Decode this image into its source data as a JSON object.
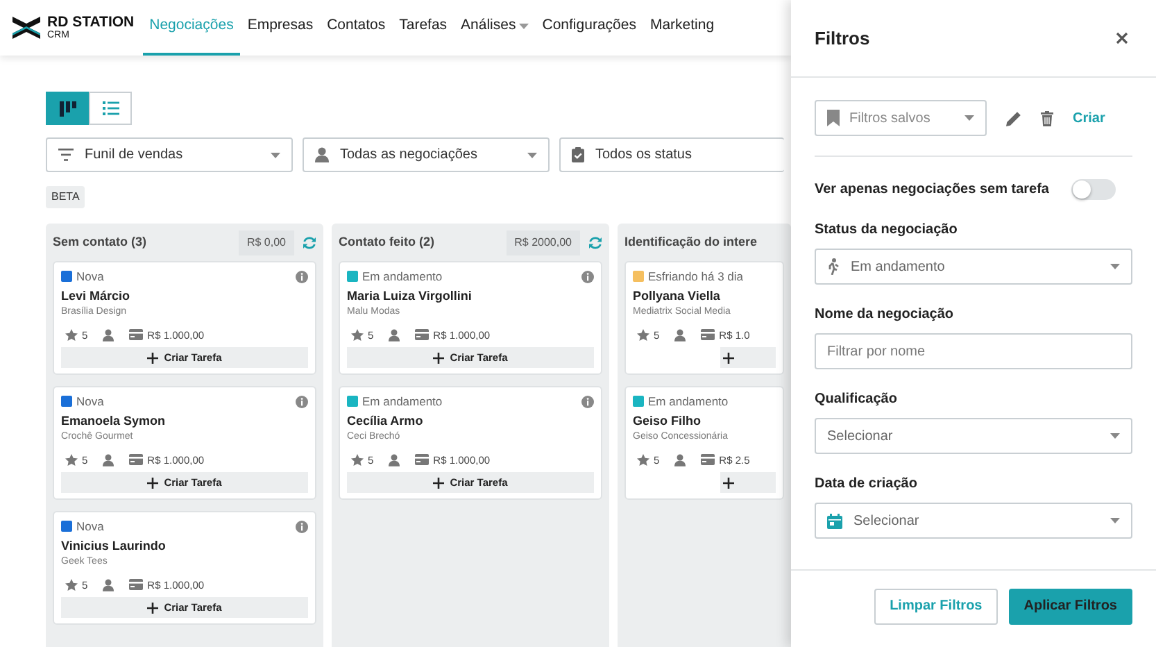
{
  "logo": {
    "brand": "RD STATION",
    "product": "CRM"
  },
  "nav": [
    {
      "label": "Negociações",
      "selected": true,
      "dropdown": false
    },
    {
      "label": "Empresas",
      "selected": false,
      "dropdown": false
    },
    {
      "label": "Contatos",
      "selected": false,
      "dropdown": false
    },
    {
      "label": "Tarefas",
      "selected": false,
      "dropdown": false
    },
    {
      "label": "Análises",
      "selected": false,
      "dropdown": true
    },
    {
      "label": "Configurações",
      "selected": false,
      "dropdown": false
    },
    {
      "label": "Marketing",
      "selected": false,
      "dropdown": false
    }
  ],
  "view_toggle": [
    {
      "kind": "board",
      "selected": true
    },
    {
      "kind": "list",
      "selected": false
    }
  ],
  "filters": [
    {
      "kind": "funnel",
      "value": "Funil de vendas"
    },
    {
      "kind": "user",
      "value": "Todas as negociações"
    },
    {
      "kind": "status",
      "value": "Todos os status"
    }
  ],
  "beta_badge": "BETA",
  "columns": [
    {
      "title": "Sem contato (3)",
      "total": "R$ 0,00",
      "cards": [
        {
          "status": "Nova",
          "color": "#1a6fd8",
          "name": "Levi Márcio",
          "company": "Brasília Design",
          "rating": "5",
          "amount": "R$ 1.000,00",
          "task_button": "Criar Tarefa"
        },
        {
          "status": "Nova",
          "color": "#1a6fd8",
          "name": "Emanoela Symon",
          "company": "Crochê Gourmet",
          "rating": "5",
          "amount": "R$ 1.000,00",
          "task_button": "Criar Tarefa"
        },
        {
          "status": "Nova",
          "color": "#1a6fd8",
          "name": "Vinicius Laurindo",
          "company": "Geek Tees",
          "rating": "5",
          "amount": "R$ 1.000,00",
          "task_button": "Criar Tarefa"
        }
      ]
    },
    {
      "title": "Contato feito (2)",
      "total": "R$ 2000,00",
      "cards": [
        {
          "status": "Em andamento",
          "color": "#1ab5c1",
          "name": "Maria Luiza Virgollini",
          "company": "Malu Modas",
          "rating": "5",
          "amount": "R$ 1.000,00",
          "task_button": "Criar Tarefa"
        },
        {
          "status": "Em andamento",
          "color": "#1ab5c1",
          "name": "Cecília Armo",
          "company": "Ceci Brechó",
          "rating": "5",
          "amount": "R$ 1.000,00",
          "task_button": "Criar Tarefa"
        }
      ]
    },
    {
      "title": "Identificação do intere",
      "cards": [
        {
          "status": "Esfriando há 3 dia",
          "color": "#f5bf5f",
          "name": "Pollyana Viella",
          "company": "Mediatrix Social Media",
          "rating": "5",
          "amount": "R$ 1.0"
        },
        {
          "status": "Em andamento",
          "color": "#1ab5c1",
          "name": "Geiso Filho",
          "company": "Geiso Concessionária",
          "rating": "5",
          "amount": "R$ 2.5"
        }
      ]
    }
  ],
  "panel": {
    "title": "Filtros",
    "saved_filters": {
      "placeholder": "Filtros salvos"
    },
    "create_link": "Criar",
    "no_task_toggle": {
      "label": "Ver apenas negociações sem tarefa",
      "on": false
    },
    "fields": [
      {
        "kind": "status_select",
        "label": "Status da negociação",
        "value": "Em andamento"
      },
      {
        "kind": "text",
        "label": "Nome da negociação",
        "placeholder": "Filtrar por nome"
      },
      {
        "kind": "select",
        "label": "Qualificação",
        "value": "Selecionar"
      },
      {
        "kind": "date_select",
        "label": "Data de criação",
        "value": "Selecionar"
      }
    ],
    "buttons": [
      {
        "label": "Limpar Filtros",
        "kind": "outline"
      },
      {
        "label": "Aplicar Filtros",
        "kind": "primary"
      }
    ]
  }
}
